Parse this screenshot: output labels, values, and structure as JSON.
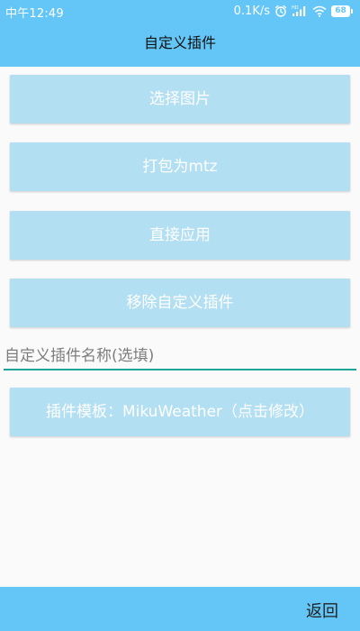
{
  "status_bar": {
    "time": "中午12:49",
    "net_speed": "0.1K/s",
    "battery_level": "68",
    "icons": [
      "alarm-icon",
      "signal-hd-icon",
      "wifi-icon",
      "battery-icon"
    ]
  },
  "header": {
    "title": "自定义插件"
  },
  "buttons": {
    "choose_image": "选择图片",
    "pack_mtz": "打包为mtz",
    "apply_directly": "直接应用",
    "remove_plugin": "移除自定义插件",
    "template": "插件模板：MikuWeather（点击修改）"
  },
  "name_field": {
    "value": "",
    "placeholder": "自定义插件名称(选填)"
  },
  "bottom_bar": {
    "back_label": "返回"
  },
  "colors": {
    "primary": "#63c6f7",
    "button": "#b3dff2",
    "accent_underline": "#1aa596",
    "background": "#fafafa"
  }
}
